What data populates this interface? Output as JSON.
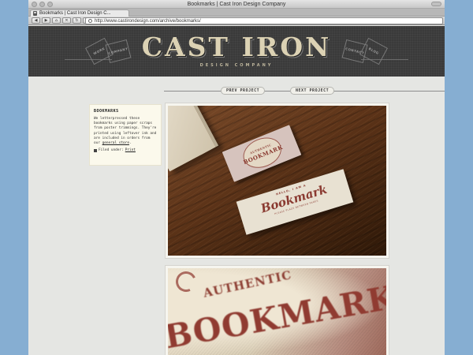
{
  "browser": {
    "window_title": "Bookmarks | Cast Iron Design Company",
    "tab_title": "Bookmarks | Cast Iron Design C...",
    "url": "http://www.castirondesign.com/archive/bookmarks/",
    "nav_buttons": [
      "◀",
      "▶",
      "⌂",
      "✕",
      "↻",
      "+"
    ]
  },
  "header": {
    "logo_main": "CAST IRON",
    "logo_sub": "DESIGN COMPANY",
    "flags": [
      "WORK",
      "COMPANY",
      "CONTACT",
      "BLOG"
    ]
  },
  "project_nav": {
    "prev": "PREV PROJECT",
    "next": "NEXT PROJECT"
  },
  "sidebar": {
    "title": "BOOKMARKS",
    "text_before": "We letterpressed these bookmarks using paper scraps from poster trimmings. They're printed using leftover ink and are included in orders from our",
    "link": "general store",
    "text_after": ".",
    "filed_label": "Filed under:",
    "filed_link": "Print"
  },
  "photo1": {
    "card1_top": "AUTHENTIC",
    "card1_main": "BOOKMARK",
    "card2_top": "HELLO, I AM A",
    "card2_main": "Bookmark",
    "card2_foot": "PLEASE PLACE BETWEEN PAGES"
  },
  "photo2": {
    "top": "AUTHENTIC",
    "main": "BOOKMARK"
  }
}
